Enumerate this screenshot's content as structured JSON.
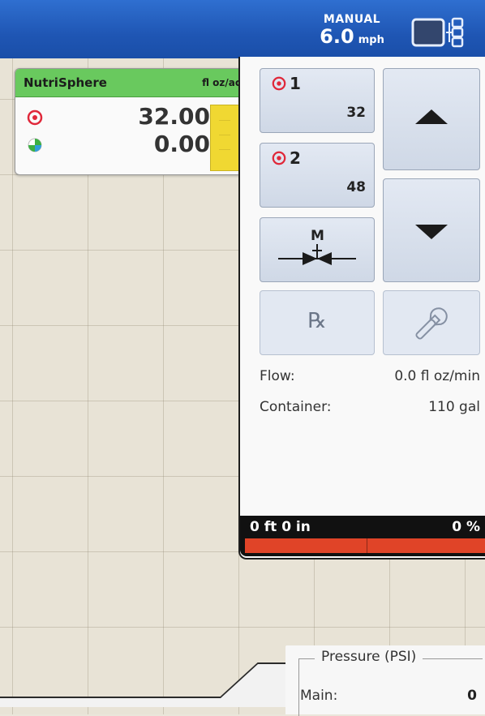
{
  "speed": {
    "mode": "MANUAL",
    "value": "6.0",
    "unit": "mph"
  },
  "product": {
    "name": "NutriSphere",
    "units": "fl oz/ac",
    "target_rate": "32.00",
    "applied_rate": "0.00",
    "target_icon": "target-icon",
    "applied_icon": "as-applied-icon"
  },
  "presets": [
    {
      "label": "1",
      "value": "32"
    },
    {
      "label": "2",
      "value": "48"
    }
  ],
  "manual_valve": {
    "label": "M"
  },
  "prescription": {
    "label": "℞"
  },
  "flow": {
    "label": "Flow:",
    "value": "0.0 fl oz/min"
  },
  "container": {
    "label": "Container:",
    "value": "110 gal"
  },
  "progress": {
    "distance": "0 ft 0 in",
    "percent": "0 %",
    "fraction": 0
  },
  "pressure": {
    "title": "Pressure (PSI)",
    "main_label": "Main:",
    "main_value": "0"
  },
  "colors": {
    "topbar": "#1f56b4",
    "product_header": "#69c95e",
    "level": "#f0d832",
    "progress": "#e04428"
  }
}
